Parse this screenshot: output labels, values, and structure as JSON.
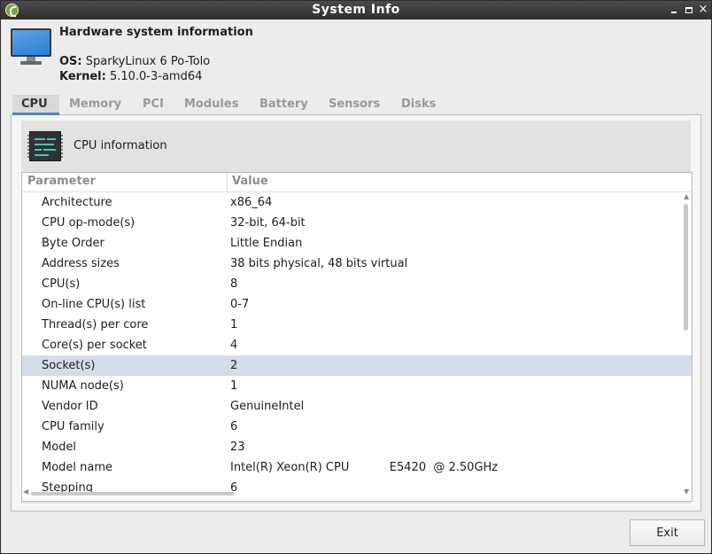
{
  "window": {
    "title": "System Info",
    "minimize_label": "",
    "close_glyph": "×"
  },
  "header": {
    "title": "Hardware system information",
    "os_label": "OS:",
    "os_value": "SparkyLinux 6 Po-Tolo",
    "kernel_label": "Kernel:",
    "kernel_value": "5.10.0-3-amd64",
    "icon": "monitor-icon"
  },
  "tabs": [
    {
      "label": "CPU",
      "active": true
    },
    {
      "label": "Memory",
      "active": false
    },
    {
      "label": "PCI",
      "active": false
    },
    {
      "label": "Modules",
      "active": false
    },
    {
      "label": "Battery",
      "active": false
    },
    {
      "label": "Sensors",
      "active": false
    },
    {
      "label": "Disks",
      "active": false
    }
  ],
  "cpu_panel": {
    "icon": "cpu-chip-icon",
    "heading": "CPU information",
    "columns": {
      "parameter": "Parameter",
      "value": "Value"
    },
    "rows": [
      {
        "parameter": "Architecture",
        "value": "x86_64"
      },
      {
        "parameter": "CPU op-mode(s)",
        "value": "32-bit, 64-bit"
      },
      {
        "parameter": "Byte Order",
        "value": "Little Endian"
      },
      {
        "parameter": "Address sizes",
        "value": "38 bits physical, 48 bits virtual"
      },
      {
        "parameter": "CPU(s)",
        "value": "8"
      },
      {
        "parameter": "On-line CPU(s) list",
        "value": "0-7"
      },
      {
        "parameter": "Thread(s) per core",
        "value": "1"
      },
      {
        "parameter": "Core(s) per socket",
        "value": "4"
      },
      {
        "parameter": "Socket(s)",
        "value": "2",
        "selected": true
      },
      {
        "parameter": "NUMA node(s)",
        "value": "1"
      },
      {
        "parameter": "Vendor ID",
        "value": "GenuineIntel"
      },
      {
        "parameter": "CPU family",
        "value": "6"
      },
      {
        "parameter": "Model",
        "value": "23"
      },
      {
        "parameter": "Model name",
        "value": "Intel(R) Xeon(R) CPU           E5420  @ 2.50GHz"
      },
      {
        "parameter": "Stepping",
        "value": "6"
      }
    ]
  },
  "footer": {
    "exit_label": "Exit"
  },
  "colors": {
    "accent": "#4d86c7",
    "selection": "#d3dce8",
    "chip_lines": "#4ec5b0"
  }
}
